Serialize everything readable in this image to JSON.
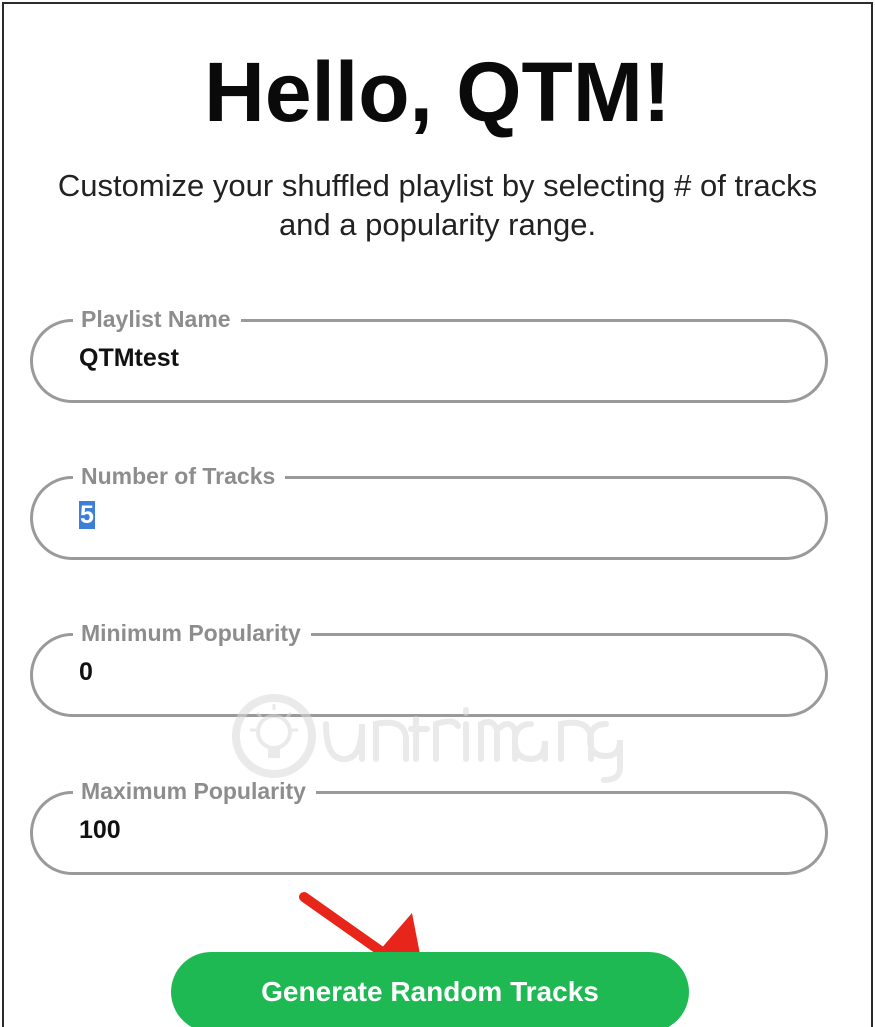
{
  "header": {
    "title": "Hello, QTM!",
    "subtitle": "Customize your shuffled playlist by selecting # of tracks and a popularity range."
  },
  "form": {
    "playlist_name": {
      "label": "Playlist Name",
      "value": "QTMtest"
    },
    "number_of_tracks": {
      "label": "Number of Tracks",
      "value": "5"
    },
    "minimum_popularity": {
      "label": "Minimum Popularity",
      "value": "0"
    },
    "maximum_popularity": {
      "label": "Maximum Popularity",
      "value": "100"
    }
  },
  "actions": {
    "generate_label": "Generate Random Tracks"
  },
  "colors": {
    "accent_green": "#1fb954",
    "field_border": "#9a9a9a",
    "label_gray": "#8d8d8d",
    "selection_blue": "#3d7fd6",
    "annotation_arrow": "#e8251b"
  },
  "decorations": {
    "watermark_icon": "lightbulb-logo-icon",
    "annotation_icon": "red-arrow-icon"
  }
}
